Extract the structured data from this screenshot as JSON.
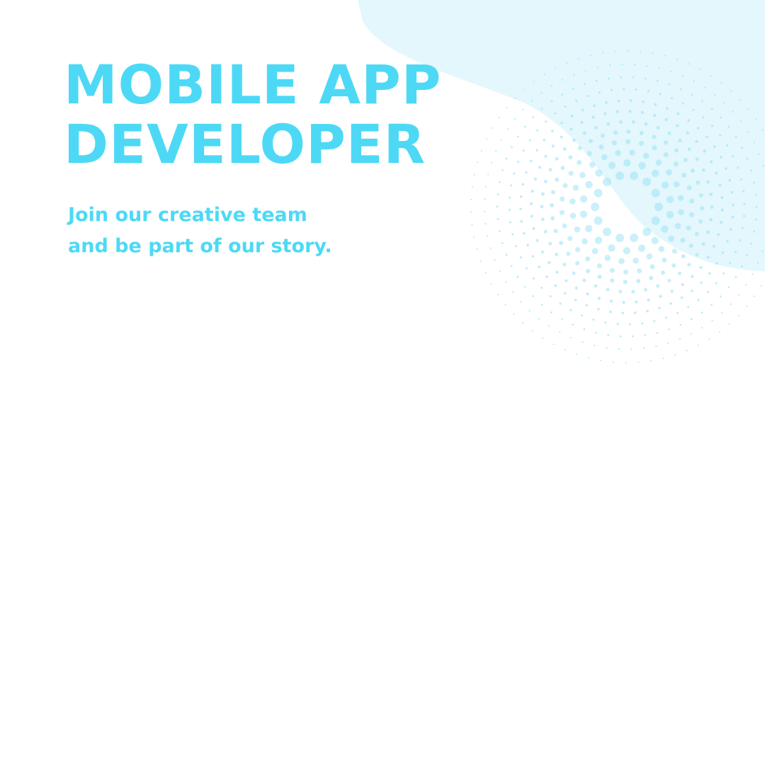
{
  "colors": {
    "accent": "#4dd9f5",
    "blob": "#e3f7fc",
    "background": "#ffffff"
  },
  "headline": {
    "line1": "MOBILE APP",
    "line2": "DEVELOPER"
  },
  "tagline": {
    "line1": "Join  our creative team",
    "line2": "and be part of our story."
  }
}
